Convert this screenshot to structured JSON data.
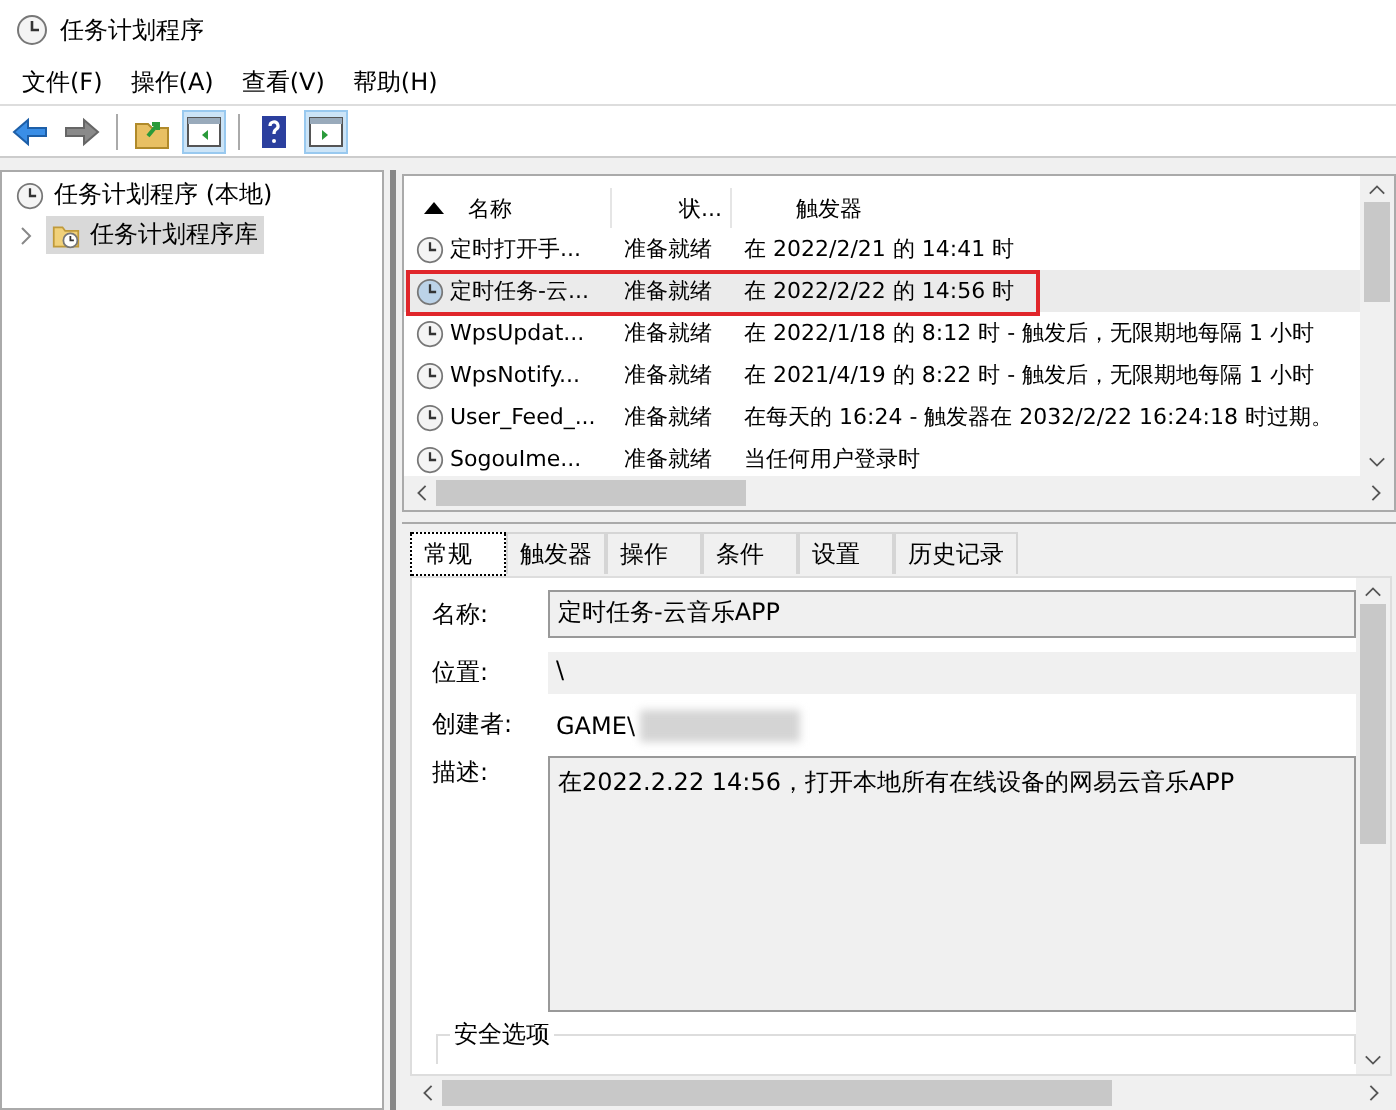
{
  "window": {
    "title": "任务计划程序"
  },
  "menu": [
    "文件(F)",
    "操作(A)",
    "查看(V)",
    "帮助(H)"
  ],
  "toolbar": [
    {
      "kind": "back"
    },
    {
      "kind": "forward"
    },
    {
      "kind": "sep"
    },
    {
      "kind": "folder-up"
    },
    {
      "kind": "pane-left"
    },
    {
      "kind": "sep"
    },
    {
      "kind": "help"
    },
    {
      "kind": "pane-right"
    }
  ],
  "tree": [
    {
      "label": "任务计划程序 (本地)",
      "selected": false,
      "children": [
        {
          "label": "任务计划程序库",
          "selected": true,
          "expanded": false
        }
      ]
    }
  ],
  "table": {
    "columns": [
      "名称",
      "状...",
      "触发器"
    ],
    "rows": [
      {
        "name": "定时打开手...",
        "status": "准备就绪",
        "trigger": "在 2022/2/21 的 14:41 时",
        "selected": false,
        "highlighted": false
      },
      {
        "name": "定时任务-云...",
        "status": "准备就绪",
        "trigger": "在 2022/2/22 的 14:56 时",
        "selected": true,
        "highlighted": true
      },
      {
        "name": "WpsUpdat...",
        "status": "准备就绪",
        "trigger": "在 2022/1/18 的 8:12 时 - 触发后，无限期地每隔 1 小时",
        "selected": false,
        "highlighted": false
      },
      {
        "name": "WpsNotify...",
        "status": "准备就绪",
        "trigger": "在 2021/4/19 的 8:22 时 - 触发后，无限期地每隔 1 小时",
        "selected": false,
        "highlighted": false
      },
      {
        "name": "User_Feed_...",
        "status": "准备就绪",
        "trigger": "在每天的 16:24 - 触发器在 2032/2/22 16:24:18 时过期。",
        "selected": false,
        "highlighted": false
      },
      {
        "name": "SogouIme...",
        "status": "准备就绪",
        "trigger": "当任何用户登录时",
        "selected": false,
        "highlighted": false
      }
    ]
  },
  "details": {
    "tabs": [
      {
        "label": "常规",
        "selected": true
      },
      {
        "label": "触发器",
        "selected": false
      },
      {
        "label": "操作",
        "selected": false
      },
      {
        "label": "条件",
        "selected": false
      },
      {
        "label": "设置",
        "selected": false
      },
      {
        "label": "历史记录",
        "selected": false
      }
    ],
    "name_label": "名称:",
    "name_value": "定时任务-云音乐APP",
    "location_label": "位置:",
    "location_value": "\\",
    "author_label": "创建者:",
    "author_value": "GAME\\",
    "description_label": "描述:",
    "description_value": "在2022.2.22 14:56，打开本地所有在线设备的网易云音乐APP",
    "security_group": "安全选项"
  }
}
